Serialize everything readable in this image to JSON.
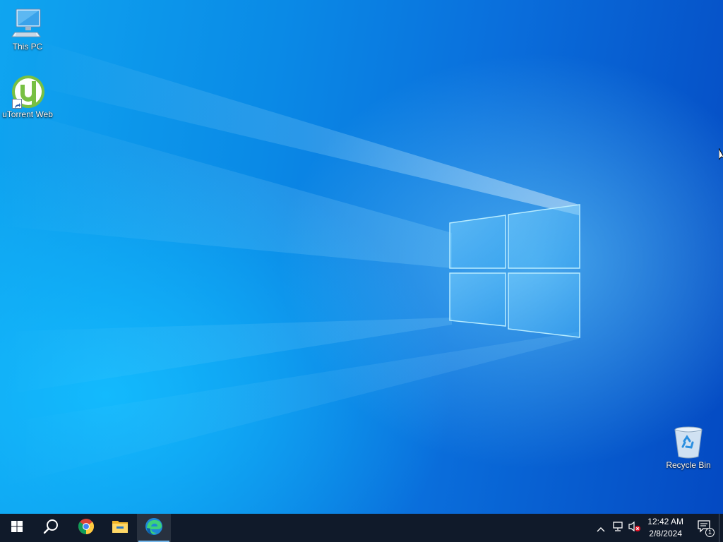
{
  "desktop": {
    "icons": [
      {
        "label": "This PC",
        "icon": "computer-icon"
      },
      {
        "label": "uTorrent Web",
        "icon": "utorrent-icon"
      },
      {
        "label": "Recycle Bin",
        "icon": "recycle-bin-icon"
      }
    ]
  },
  "taskbar": {
    "items": [
      {
        "name": "start",
        "icon": "windows-logo-icon"
      },
      {
        "name": "search",
        "icon": "search-icon"
      },
      {
        "name": "chrome",
        "icon": "chrome-icon"
      },
      {
        "name": "file-explorer",
        "icon": "folder-icon"
      },
      {
        "name": "edge",
        "icon": "edge-icon",
        "active": true
      }
    ],
    "tray": {
      "icons": [
        "chevron-up-icon",
        "network-icon",
        "volume-muted-icon"
      ],
      "time": "12:42 AM",
      "date": "2/8/2024",
      "notification_count": "1"
    }
  },
  "colors": {
    "taskbar_bg": "#101a2a",
    "wallpaper_accent": "#0a6fdc",
    "active_indicator": "#76b9ed"
  }
}
